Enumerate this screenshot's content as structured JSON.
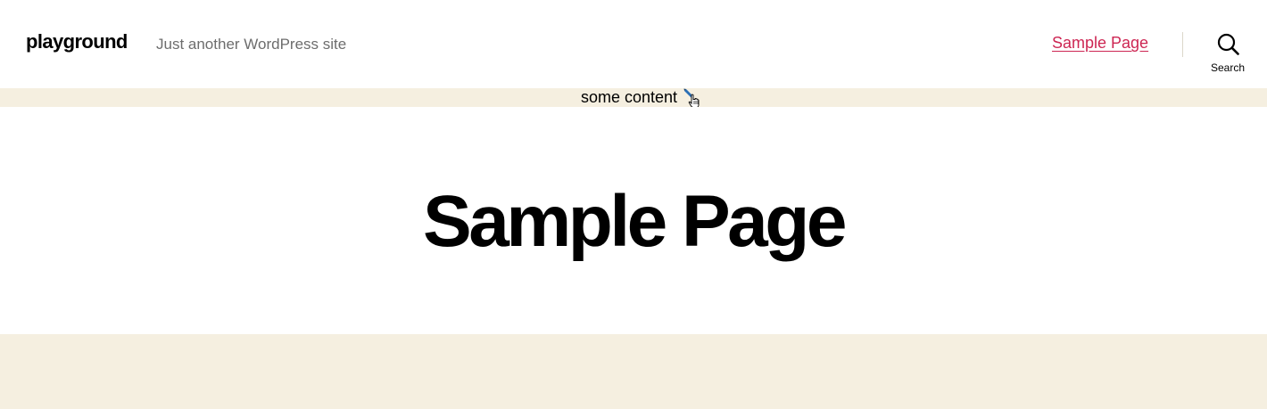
{
  "header": {
    "site_title": "playground",
    "tagline": "Just another WordPress site",
    "nav": {
      "items": [
        {
          "label": "Sample Page"
        }
      ]
    },
    "search": {
      "label": "Search",
      "icon": "search-icon"
    }
  },
  "notice": {
    "text": "some content",
    "icon": "edit-pencil-icon"
  },
  "page": {
    "title": "Sample Page"
  },
  "colors": {
    "accent": "#cd2653",
    "band_background": "#f5efe0",
    "tagline": "#6d6d6d"
  }
}
